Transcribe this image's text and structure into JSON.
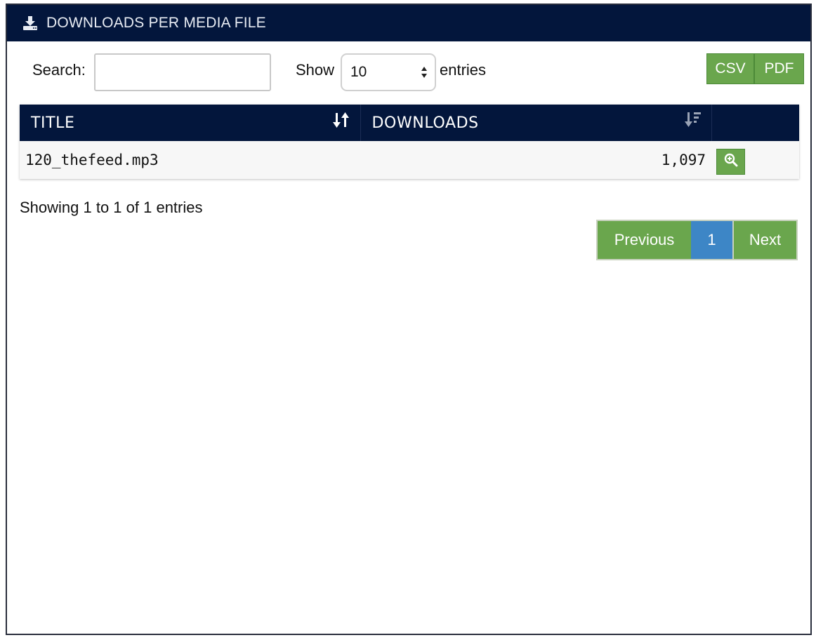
{
  "panel": {
    "title": "DOWNLOADS PER MEDIA FILE",
    "icon": "download-icon",
    "header_color": "#03163c"
  },
  "controls": {
    "search_label": "Search:",
    "search_value": "",
    "show_label": "Show",
    "page_length": "10",
    "entries_label": "entries",
    "export_buttons": [
      "CSV",
      "PDF"
    ],
    "button_color": "#6aa64d"
  },
  "table": {
    "columns": [
      {
        "label": "TITLE",
        "sort_icon": "sort-both-icon"
      },
      {
        "label": "DOWNLOADS",
        "sort_icon": "sort-desc-icon"
      },
      {
        "label": ""
      }
    ],
    "rows": [
      {
        "title": "120_thefeed.mp3",
        "downloads": "1,097",
        "action_icon": "zoom-in-icon"
      }
    ]
  },
  "footer": {
    "info": "Showing 1 to 1 of 1 entries",
    "pagination": {
      "previous": "Previous",
      "current": "1",
      "next": "Next"
    },
    "current_color": "#3d86c6"
  }
}
